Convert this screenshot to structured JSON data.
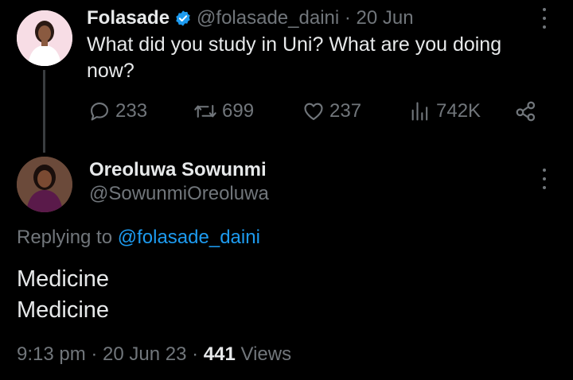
{
  "parent_tweet": {
    "author_name": "Folasade",
    "handle_date": "@folasade_daini · 20 Jun",
    "text": "What did you study in Uni? What are you doing now?",
    "stats": {
      "replies": "233",
      "retweets": "699",
      "likes": "237",
      "views": "742K"
    },
    "icons": [
      "verified-badge-icon",
      "reply-icon",
      "retweet-icon",
      "heart-icon",
      "views-icon",
      "share-icon",
      "more-icon"
    ]
  },
  "reply_tweet": {
    "author_name": "Oreoluwa Sowunmi",
    "handle": "@SowunmiOreoluwa",
    "replying_prefix": "Replying to",
    "replying_mention": "@folasade_daini",
    "text_lines": [
      "Medicine",
      "Medicine"
    ],
    "timestamp": "9:13 pm · 20 Jun 23 · ",
    "views_count": "441",
    "views_label": " Views"
  },
  "colors": {
    "background": "#000000",
    "primary_text": "#e7e9ea",
    "secondary_text": "#71767b",
    "accent": "#1d9bf0"
  }
}
